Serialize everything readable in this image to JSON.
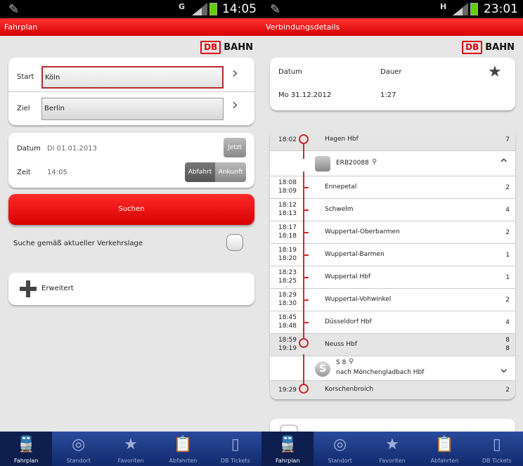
{
  "left": {
    "status": {
      "network": "G",
      "time": "14:05"
    },
    "title": "Fahrplan",
    "brand": {
      "db": "DB",
      "bahn": "BAHN"
    },
    "start": {
      "label": "Start",
      "value": "Köln"
    },
    "ziel": {
      "label": "Ziel",
      "value": "Berlin"
    },
    "datum": {
      "label": "Datum",
      "value": "Di 01.01.2013",
      "now_button": "Jetzt"
    },
    "zeit": {
      "label": "Zeit",
      "value": "14:05",
      "abfahrt": "Abfahrt",
      "ankunft": "Ankunft"
    },
    "search_button": "Suchen",
    "traffic_option": "Suche gemäß aktueller Verkehrslage",
    "extended": "Erweitert"
  },
  "right": {
    "status": {
      "network": "H",
      "time": "23:01"
    },
    "title": "Verbindungsdetails",
    "brand": {
      "db": "DB",
      "bahn": "BAHN"
    },
    "summary": {
      "datum_label": "Datum",
      "dauer_label": "Dauer",
      "datum": "Mo 31.12.2012",
      "dauer": "1:27"
    },
    "first": {
      "time": "18:02",
      "station": "Hagen Hbf",
      "platform": "7"
    },
    "train1": {
      "name": "ERB20088"
    },
    "stops": [
      {
        "arr": "18:08",
        "dep": "18:09",
        "station": "Ennepetal",
        "platform": "2"
      },
      {
        "arr": "18:12",
        "dep": "18:13",
        "station": "Schwelm",
        "platform": "4"
      },
      {
        "arr": "18:17",
        "dep": "18:18",
        "station": "Wuppertal-Oberbarmen",
        "platform": "2"
      },
      {
        "arr": "18:19",
        "dep": "18:20",
        "station": "Wuppertal-Barmen",
        "platform": "1"
      },
      {
        "arr": "18:23",
        "dep": "18:25",
        "station": "Wuppertal Hbf",
        "platform": "1"
      },
      {
        "arr": "18:29",
        "dep": "18:30",
        "station": "Wuppertal-Vohwinkel",
        "platform": "2"
      },
      {
        "arr": "18:45",
        "dep": "18:48",
        "station": "Düsseldorf Hbf",
        "platform": "4"
      }
    ],
    "transfer": {
      "arr": "18:59",
      "dep": "19:19",
      "station": "Neuss Hbf",
      "platform_arr": "8",
      "platform_dep": "8"
    },
    "train2": {
      "name": "S 8",
      "direction": "nach Mönchengladbach Hbf",
      "badge": "S"
    },
    "last": {
      "time": "19:29",
      "station": "Korschenbroich",
      "platform": "2"
    }
  },
  "nav": [
    {
      "label": "Fahrplan",
      "icon": "train-icon"
    },
    {
      "label": "Standort",
      "icon": "target-icon"
    },
    {
      "label": "Favoriten",
      "icon": "star-icon"
    },
    {
      "label": "Abfahrten",
      "icon": "clipboard-clock-icon"
    },
    {
      "label": "DB Tickets",
      "icon": "tickets-icon"
    }
  ],
  "colors": {
    "accent": "#e30613",
    "navbar": "#1a3480",
    "timeline": "#c23030"
  }
}
